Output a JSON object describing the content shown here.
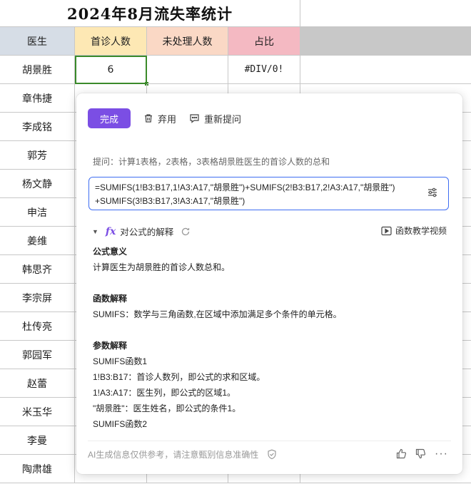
{
  "sheet": {
    "title": "2024年8月流失率统计",
    "headers": {
      "doctor": "医生",
      "first_visit": "首诊人数",
      "unprocessed": "未处理人数",
      "ratio": "占比"
    },
    "rows": [
      {
        "name": "胡景胜",
        "first_visit": "6",
        "unprocessed": "",
        "ratio": "#DIV/0!"
      },
      {
        "name": "章伟捷"
      },
      {
        "name": "李成铭"
      },
      {
        "name": "郭芳"
      },
      {
        "name": "杨文静"
      },
      {
        "name": "申洁"
      },
      {
        "name": "姜维"
      },
      {
        "name": "韩思齐"
      },
      {
        "name": "李宗屏"
      },
      {
        "name": "杜传亮"
      },
      {
        "name": "郭园军"
      },
      {
        "name": "赵蕾"
      },
      {
        "name": "米玉华"
      },
      {
        "name": "李曼"
      },
      {
        "name": "陶肃雄"
      }
    ]
  },
  "panel": {
    "done_label": "完成",
    "discard_label": "弃用",
    "reask_label": "重新提问",
    "prompt_text": "提问：计算1表格，2表格，3表格胡景胜医生的首诊人数的总和",
    "formula_line1": "=SUMIFS(1!B3:B17,1!A3:A17,\"胡景胜\")+SUMIFS(2!B3:B17,2!A3:A17,\"胡景胜\")",
    "formula_line2": "+SUMIFS(3!B3:B17,3!A3:A17,\"胡景胜\")",
    "explain_title": "对公式的解释",
    "video_label": "函数教学视频",
    "sections": {
      "meaning_title": "公式意义",
      "meaning_text": "计算医生为胡景胜的首诊人数总和。",
      "func_title": "函数解释",
      "func_text": "SUMIFS：数学与三角函数,在区域中添加满足多个条件的单元格。",
      "param_title": "参数解释",
      "param_lines": [
        "SUMIFS函数1",
        "1!B3:B17：首诊人数列，即公式的求和区域。",
        "1!A3:A17：医生列，即公式的区域1。",
        "\"胡景胜\"：医生姓名，即公式的条件1。",
        "SUMIFS函数2"
      ]
    },
    "disclaimer": "AI生成信息仅供参考，请注意甄别信息准确性"
  },
  "colors": {
    "accent": "#7b4ee4",
    "focus_border": "#3e6df2",
    "header_doctor": "#d6dde6",
    "header_first": "#fde8b4",
    "header_unproc": "#fad8c5",
    "header_ratio": "#f4b9c2",
    "selection": "#3a8a2a"
  }
}
